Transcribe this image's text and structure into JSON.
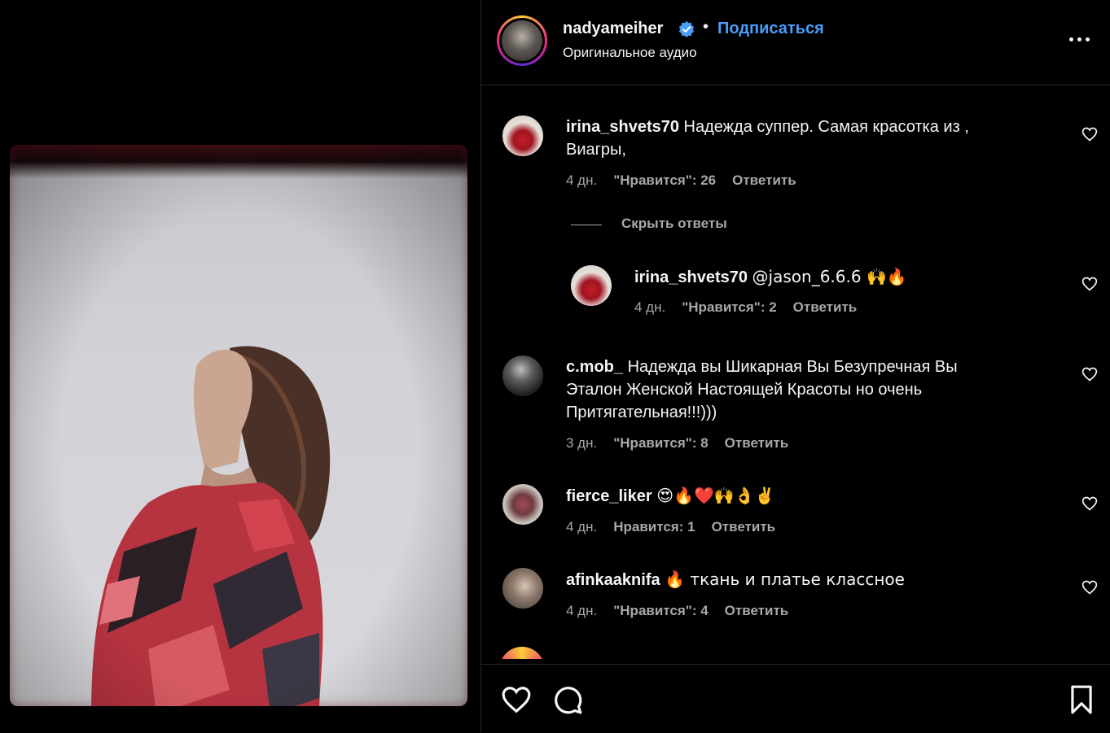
{
  "post": {
    "username": "nadyameiher",
    "follow_label": "Подписаться",
    "separator": "•",
    "audio_label": "Оригинальное аудио"
  },
  "comments": [
    {
      "username": "irina_shvets70",
      "text_line1": "Надежда суппер. Самая красотка из ,",
      "text_line2": "Виагры,",
      "time": "4 дн.",
      "likes": "\"Нравится\": 26",
      "reply_label": "Ответить",
      "hide_replies_label": "Скрыть ответы",
      "avatar_colors": [
        "#c21d2a",
        "#e8e0d8"
      ]
    },
    {
      "username": "irina_shvets70",
      "text": "@jason_6.6.6 🙌🔥",
      "time": "4 дн.",
      "likes": "\"Нравится\": 2",
      "reply_label": "Ответить",
      "is_reply": true
    },
    {
      "username": "c.mob_",
      "text_line1": "Надежда вы Шикарная Вы Безупречная Вы",
      "text_line2": "Эталон Женской Настоящей Красоты но очень",
      "text_line3": "Притягательная!!!)))",
      "time": "3 дн.",
      "likes": "\"Нравится\": 8",
      "reply_label": "Ответить"
    },
    {
      "username": "fierce_liker",
      "text": "😍🔥❤️🙌👌✌️",
      "time": "4 дн.",
      "likes": "Нравится: 1",
      "reply_label": "Ответить"
    },
    {
      "username": "afinkaaknifa",
      "text": "🔥 ткань и платье классное",
      "time": "4 дн.",
      "likes": "\"Нравится\": 4",
      "reply_label": "Ответить"
    }
  ],
  "icons": {
    "like": "heart-icon",
    "comment": "comment-icon",
    "save": "bookmark-icon",
    "more": "more-options-icon",
    "verified": "verified-badge-icon"
  },
  "colors": {
    "accent": "#4a9df8",
    "muted": "#a8a8a8",
    "background": "#000000"
  }
}
